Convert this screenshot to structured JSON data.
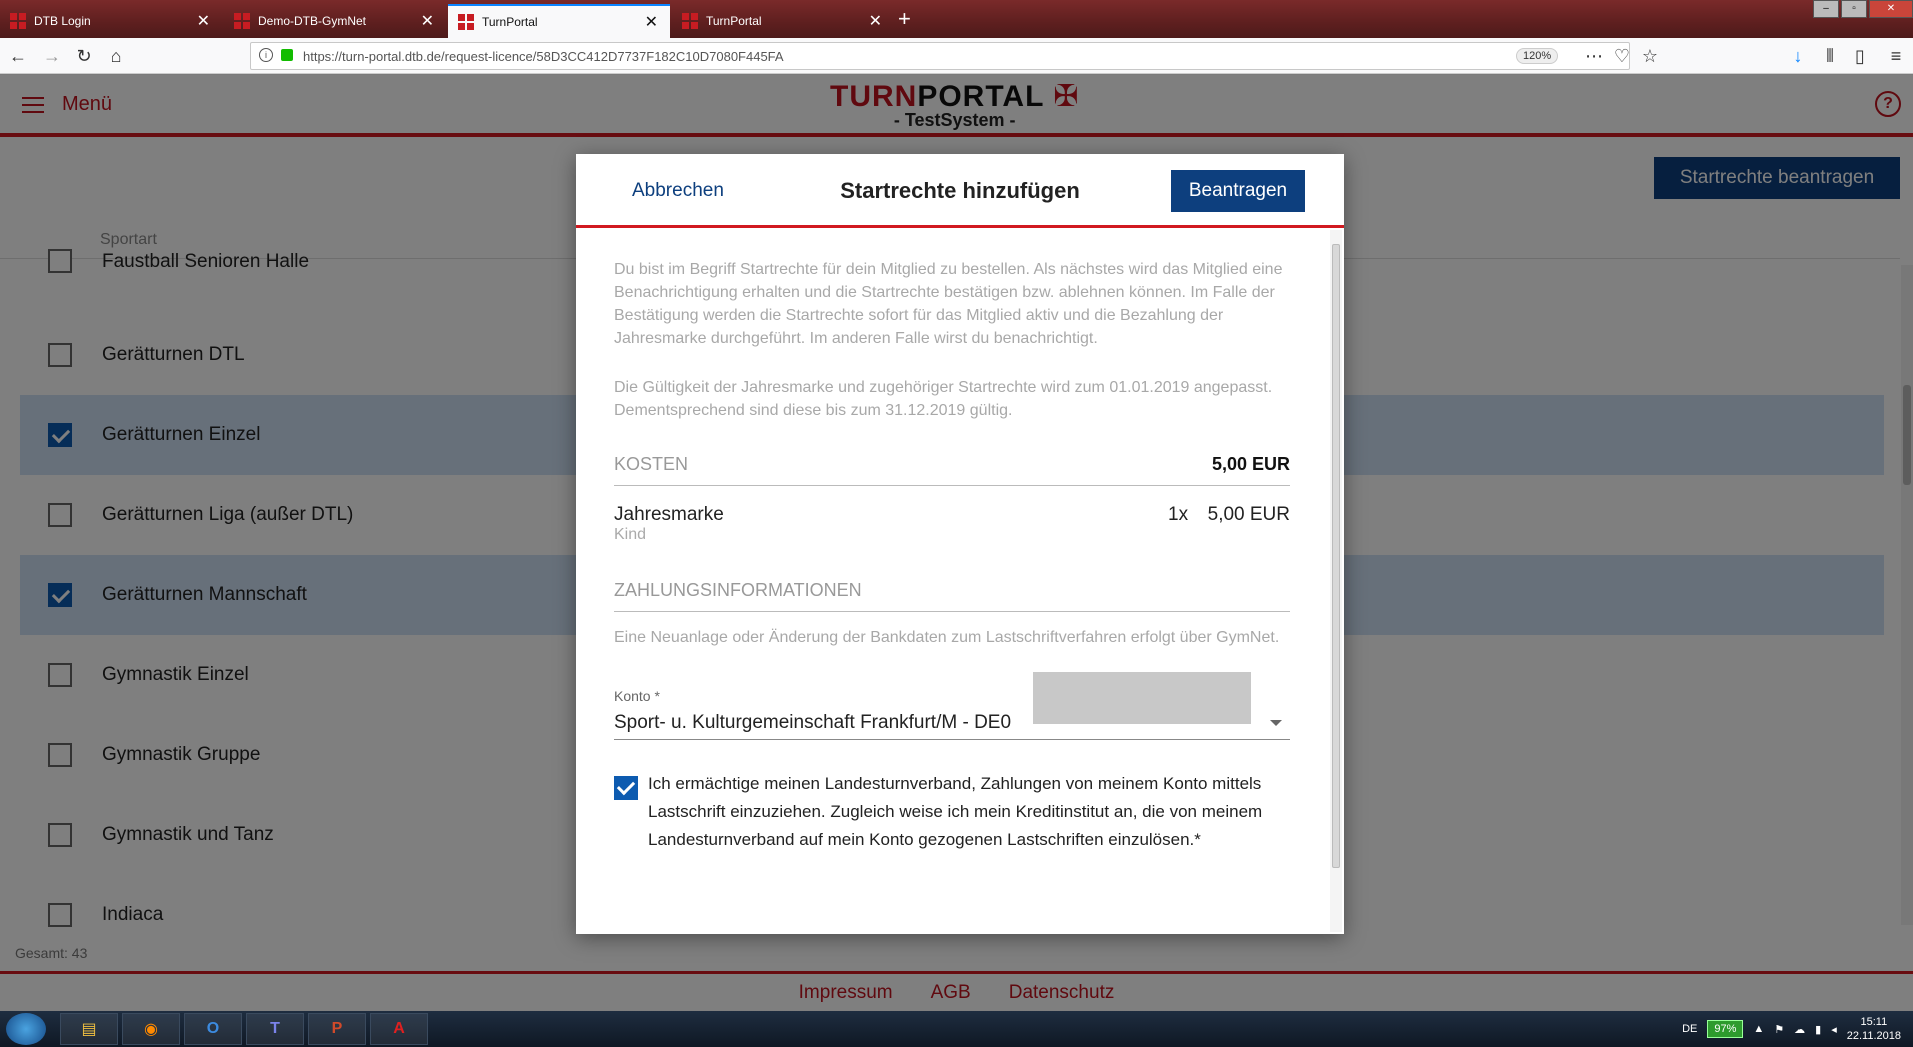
{
  "browser": {
    "tabs": [
      {
        "title": "DTB Login"
      },
      {
        "title": "Demo-DTB-GymNet"
      },
      {
        "title": "TurnPortal"
      },
      {
        "title": "TurnPortal"
      }
    ],
    "url": "https://turn-portal.dtb.de/request-licence/58D3CC412D7737F182C10D7080F445FA",
    "zoom": "120%"
  },
  "app": {
    "menu_label": "Menü",
    "logo_red": "TURN",
    "logo_black": "PORTAL",
    "subtitle": "- TestSystem -",
    "request_button": "Startrechte beantragen",
    "column_header": "Sportart",
    "list": [
      {
        "label": "Faustball Senioren Halle",
        "checked": false
      },
      {
        "label": "Gerätturnen DTL",
        "checked": false
      },
      {
        "label": "Gerätturnen Einzel",
        "checked": true
      },
      {
        "label": "Gerätturnen Liga (außer DTL)",
        "checked": false
      },
      {
        "label": "Gerätturnen Mannschaft",
        "checked": true
      },
      {
        "label": "Gymnastik Einzel",
        "checked": false
      },
      {
        "label": "Gymnastik Gruppe",
        "checked": false
      },
      {
        "label": "Gymnastik und Tanz",
        "checked": false
      },
      {
        "label": "Indiaca",
        "checked": false
      }
    ],
    "total": "Gesamt: 43",
    "footer": {
      "impressum": "Impressum",
      "agb": "AGB",
      "datenschutz": "Datenschutz"
    }
  },
  "modal": {
    "cancel": "Abbrechen",
    "title": "Startrechte hinzufügen",
    "submit": "Beantragen",
    "intro": "Du bist im Begriff Startrechte für dein Mitglied zu bestellen. Als nächstes wird das Mitglied eine Benachrichtigung erhalten und die Startrechte bestätigen bzw. ablehnen können. Im Falle der Bestätigung werden die Startrechte sofort für das Mitglied aktiv und die Bezahlung der Jahresmarke durchgeführt. Im anderen Falle wirst du benachrichtigt.",
    "validity": "Die Gültigkeit der Jahresmarke und zugehöriger Startrechte wird zum 01.01.2019 angepasst. Dementsprechend sind diese bis zum 31.12.2019 gültig.",
    "costs_label": "KOSTEN",
    "costs_total": "5,00 EUR",
    "item_name": "Jahresmarke",
    "item_sub": "Kind",
    "item_qty": "1x",
    "item_price": "5,00 EUR",
    "payment_label": "ZAHLUNGSINFORMATIONEN",
    "payment_info": "Eine Neuanlage oder Änderung der Bankdaten zum Lastschriftverfahren erfolgt über GymNet.",
    "account_label": "Konto *",
    "account_value": "Sport- u. Kulturgemeinschaft Frankfurt/M - DE0",
    "mandate_checked": true,
    "mandate_text": "Ich ermächtige meinen Landesturnverband, Zahlungen von meinem Konto mittels Lastschrift einzuziehen. Zugleich weise ich mein Kreditinstitut an, die von meinem Landesturnverband auf mein Konto gezogenen Lastschriften einzulösen.*"
  },
  "taskbar": {
    "lang": "DE",
    "battery": "97%",
    "time": "15:11",
    "date": "22.11.2018"
  },
  "colors": {
    "brand_red": "#c1121f",
    "primary_blue": "#0d3f7e",
    "selected_row": "#cfe0f5"
  }
}
